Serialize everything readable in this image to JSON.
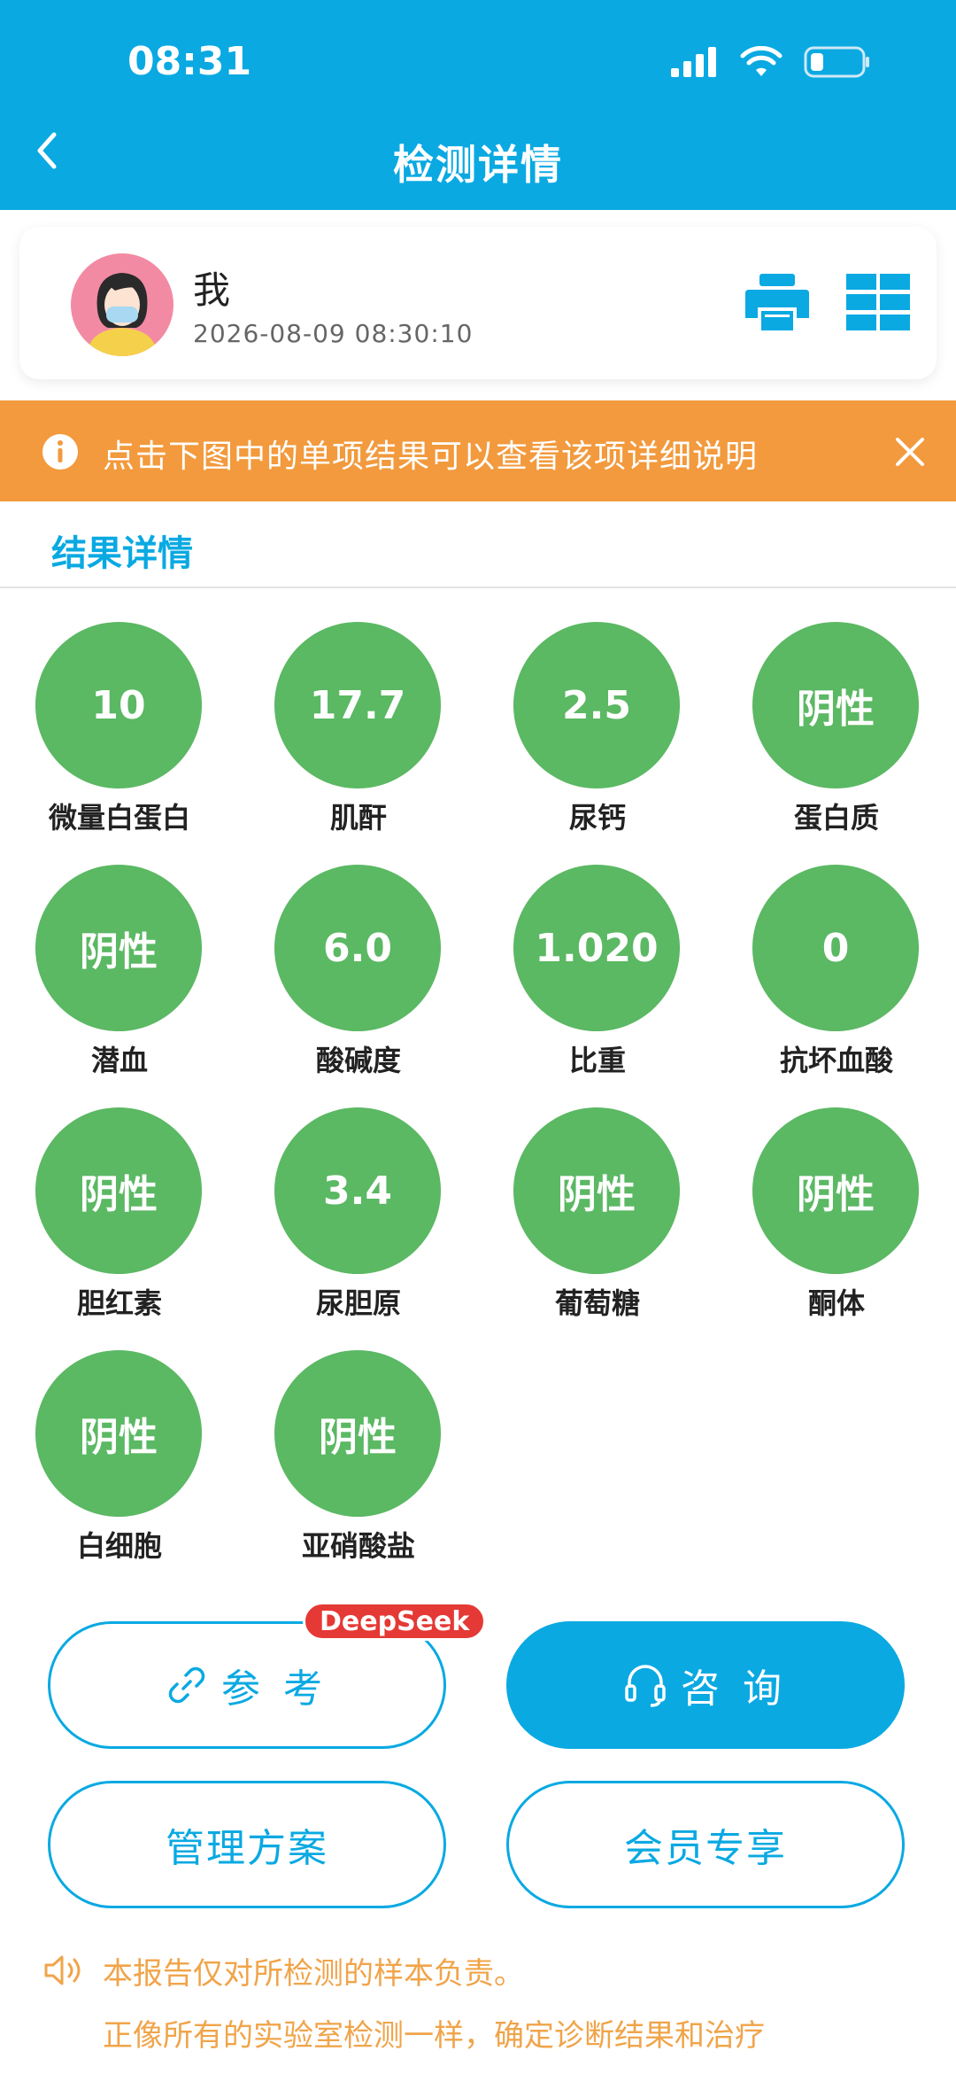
{
  "status_bar": {
    "time": "08:31"
  },
  "header": {
    "title": "检测详情"
  },
  "profile": {
    "name": "我",
    "datetime": "2026-08-09 08:30:10"
  },
  "notice": {
    "text": "点击下图中的单项结果可以查看该项详细说明"
  },
  "section": {
    "title": "结果详情"
  },
  "results": [
    {
      "value": "10",
      "label": "微量白蛋白"
    },
    {
      "value": "17.7",
      "label": "肌酐"
    },
    {
      "value": "2.5",
      "label": "尿钙"
    },
    {
      "value": "阴性",
      "label": "蛋白质"
    },
    {
      "value": "阴性",
      "label": "潜血"
    },
    {
      "value": "6.0",
      "label": "酸碱度"
    },
    {
      "value": "1.020",
      "label": "比重"
    },
    {
      "value": "0",
      "label": "抗坏血酸"
    },
    {
      "value": "阴性",
      "label": "胆红素"
    },
    {
      "value": "3.4",
      "label": "尿胆原"
    },
    {
      "value": "阴性",
      "label": "葡萄糖"
    },
    {
      "value": "阴性",
      "label": "酮体"
    },
    {
      "value": "阴性",
      "label": "白细胞"
    },
    {
      "value": "阴性",
      "label": "亚硝酸盐"
    }
  ],
  "actions": {
    "reference": "参 考",
    "deepseek_badge": "DeepSeek",
    "consult": "咨 询",
    "management": "管理方案",
    "member": "会员专享"
  },
  "footer": {
    "line1": "本报告仅对所检测的样本负责。",
    "line2": "正像所有的实验室检测一样，确定诊断结果和治疗"
  },
  "colors": {
    "primary": "#0aa9e2",
    "notice": "#f29a3d",
    "result_circle": "#5bb863",
    "badge": "#e53935",
    "footer_text": "#f0a44a"
  }
}
